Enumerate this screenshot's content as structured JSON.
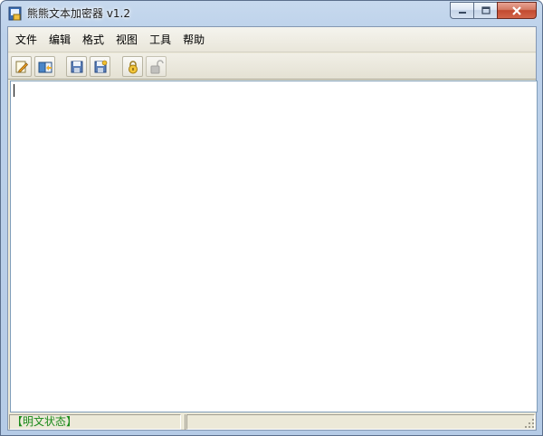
{
  "window": {
    "title": "熊熊文本加密器 v1.2"
  },
  "menubar": {
    "items": [
      {
        "label": "文件"
      },
      {
        "label": "编辑"
      },
      {
        "label": "格式"
      },
      {
        "label": "视图"
      },
      {
        "label": "工具"
      },
      {
        "label": "帮助"
      }
    ]
  },
  "toolbar": {
    "buttons": [
      {
        "icon": "new-document-icon",
        "enabled": true
      },
      {
        "icon": "open-book-icon",
        "enabled": true
      },
      {
        "icon": "save-icon",
        "enabled": true
      },
      {
        "icon": "save-as-icon",
        "enabled": true
      },
      {
        "icon": "lock-icon",
        "enabled": true
      },
      {
        "icon": "unlock-icon",
        "enabled": false
      }
    ]
  },
  "editor": {
    "content": ""
  },
  "statusbar": {
    "mode_text": "【明文状态】",
    "info_text": ""
  },
  "colors": {
    "status_text": "#1a8a1a",
    "close_button": "#c24a30"
  }
}
